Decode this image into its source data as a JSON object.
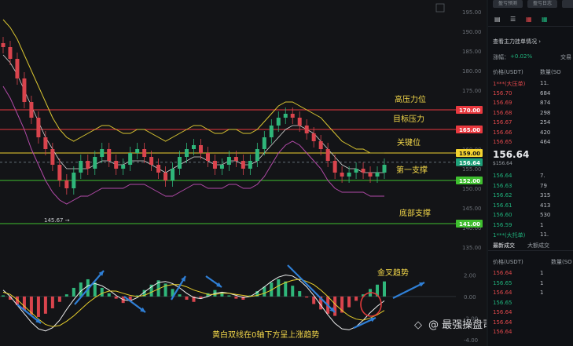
{
  "chart_data": {
    "type": "line",
    "price_axis": {
      "ticks": [
        "195.00",
        "190.00",
        "185.00",
        "180.00",
        "175.00",
        "170.00",
        "165.00",
        "160.00",
        "155.00",
        "150.00",
        "145.00",
        "140.00",
        "135.00"
      ],
      "tick_values": [
        195,
        190,
        185,
        180,
        175,
        170,
        165,
        160,
        155,
        150,
        145,
        140,
        135
      ],
      "range": [
        132,
        196
      ]
    },
    "indicator_axis": {
      "ticks": [
        "2.00",
        "0.00",
        "-2.00",
        "-4.00"
      ],
      "tick_values": [
        2,
        0,
        -2,
        -4
      ],
      "range": [
        -4.6,
        3.2
      ]
    },
    "levels": [
      {
        "label": "高压力位",
        "tag": "170.00",
        "value": 170.0,
        "color": "#e8393f"
      },
      {
        "label": "目标压力",
        "tag": "165.00",
        "value": 165.0,
        "color": "#e8393f"
      },
      {
        "label": "关键位",
        "tag": "159.00",
        "value": 159.0,
        "color": "#f2d230"
      },
      {
        "label": "第一支撑",
        "tag": "152.00",
        "value": 152.0,
        "color": "#3fbf2f"
      },
      {
        "label": "底部支撑",
        "tag": "141.00",
        "value": 141.0,
        "color": "#3fbf2f"
      }
    ],
    "current_price_tag": "156.64",
    "current_price": 156.64,
    "low_marker": "145.67",
    "close_series": [
      186,
      183,
      178,
      172,
      168,
      163,
      160,
      156,
      152,
      150,
      154,
      157,
      155,
      158,
      160,
      157,
      155,
      156,
      159,
      160,
      158,
      156,
      154,
      152,
      155,
      158,
      160,
      161,
      159,
      157,
      155,
      156,
      158,
      157,
      155,
      157,
      160,
      163,
      166,
      168,
      169,
      168,
      166,
      164,
      162,
      160,
      157,
      154,
      153,
      154,
      155,
      154,
      153,
      154,
      156
    ],
    "upper_band": [
      193,
      191,
      188,
      184,
      180,
      176,
      172,
      168,
      165,
      163,
      162,
      163,
      164,
      165,
      166,
      166,
      165,
      164,
      164,
      165,
      165,
      164,
      163,
      162,
      163,
      164,
      165,
      166,
      166,
      165,
      164,
      164,
      165,
      165,
      164,
      164,
      165,
      167,
      169,
      171,
      172,
      172,
      171,
      170,
      169,
      168,
      166,
      164,
      162,
      161,
      160,
      160,
      159,
      159,
      159
    ],
    "lower_band": [
      176,
      173,
      169,
      165,
      160,
      156,
      152,
      149,
      147,
      146,
      147,
      148,
      148,
      149,
      150,
      150,
      150,
      150,
      151,
      151,
      151,
      150,
      149,
      148,
      148,
      149,
      150,
      151,
      151,
      150,
      150,
      150,
      151,
      151,
      150,
      150,
      151,
      153,
      156,
      159,
      161,
      162,
      161,
      159,
      157,
      155,
      152,
      150,
      149,
      149,
      149,
      149,
      148,
      148,
      148
    ],
    "ma_series": [
      184,
      182,
      179,
      175,
      171,
      167,
      163,
      160,
      157,
      155,
      155,
      155,
      155,
      156,
      157,
      157,
      156,
      156,
      157,
      157,
      157,
      156,
      155,
      154,
      155,
      156,
      157,
      158,
      158,
      157,
      156,
      156,
      157,
      157,
      156,
      156,
      157,
      159,
      161,
      163,
      165,
      166,
      166,
      165,
      164,
      162,
      160,
      158,
      156,
      155,
      155,
      154,
      154,
      154,
      154
    ],
    "macd_histogram": [
      0.1,
      -0.3,
      -0.8,
      -1.3,
      -1.7,
      -1.9,
      -1.6,
      -1.1,
      -0.5,
      0.2,
      0.8,
      1.3,
      1.6,
      1.3,
      0.8,
      0.3,
      -0.2,
      -0.6,
      -0.4,
      0.1,
      0.6,
      1.1,
      1.5,
      1.2,
      0.7,
      0.2,
      -0.3,
      -0.5,
      -0.2,
      0.3,
      0.6,
      0.4,
      0.1,
      -0.2,
      -0.3,
      0.1,
      0.5,
      0.9,
      1.3,
      1.6,
      1.4,
      1.0,
      0.5,
      -0.1,
      -0.7,
      -1.2,
      -1.6,
      -1.8,
      -1.5,
      -1.0,
      -0.4,
      0.2,
      0.7,
      1.1,
      1.4
    ],
    "dif_line": [
      0.6,
      0.0,
      -0.8,
      -1.6,
      -2.4,
      -3.0,
      -3.2,
      -2.9,
      -2.2,
      -1.2,
      -0.3,
      0.5,
      1.0,
      1.2,
      1.0,
      0.6,
      0.1,
      -0.3,
      -0.4,
      -0.1,
      0.4,
      0.9,
      1.3,
      1.4,
      1.2,
      0.8,
      0.3,
      -0.1,
      -0.2,
      0.0,
      0.3,
      0.4,
      0.3,
      0.1,
      -0.1,
      0.0,
      0.4,
      0.9,
      1.4,
      1.8,
      2.0,
      1.9,
      1.5,
      0.9,
      0.1,
      -0.8,
      -1.7,
      -2.5,
      -3.0,
      -3.1,
      -2.8,
      -2.2,
      -1.5,
      -0.9,
      -0.4
    ],
    "dea_line": [
      0.4,
      0.2,
      -0.3,
      -0.9,
      -1.5,
      -2.1,
      -2.6,
      -2.8,
      -2.7,
      -2.3,
      -1.8,
      -1.2,
      -0.6,
      -0.1,
      0.3,
      0.5,
      0.5,
      0.3,
      0.1,
      0.0,
      0.1,
      0.4,
      0.7,
      1.0,
      1.1,
      1.1,
      0.9,
      0.6,
      0.4,
      0.2,
      0.2,
      0.3,
      0.3,
      0.2,
      0.1,
      0.0,
      0.1,
      0.3,
      0.6,
      1.0,
      1.3,
      1.5,
      1.6,
      1.4,
      1.1,
      0.6,
      0.0,
      -0.7,
      -1.3,
      -1.8,
      -2.1,
      -2.2,
      -2.0,
      -1.7,
      -1.3
    ],
    "annotations": [
      "金叉趋势",
      "黄白双线在0轴下方呈上涨趋势"
    ],
    "grid": false
  },
  "watermark": "最强操盘司令",
  "side_panel": {
    "top_buttons": [
      "盈亏预测",
      "盈亏日志",
      ""
    ],
    "section_link": "查看主力挂单情况",
    "change_label": "涨幅：",
    "change_value": "+0.02%",
    "change_right": "交易",
    "col_price": "价格(USDT)",
    "col_qty": "数量(SO",
    "ask_rows": [
      {
        "price": "1***(大压单)",
        "qty": "11."
      },
      {
        "price": "156.70",
        "qty": "684"
      },
      {
        "price": "156.69",
        "qty": "874"
      },
      {
        "price": "156.68",
        "qty": "298"
      },
      {
        "price": "156.67",
        "qty": "254"
      },
      {
        "price": "156.66",
        "qty": "420"
      },
      {
        "price": "156.65",
        "qty": "464"
      }
    ],
    "last_price": "156.64",
    "last_price_sub": "$156.64",
    "bid_rows": [
      {
        "price": "156.64",
        "qty": "7."
      },
      {
        "price": "156.63",
        "qty": "79"
      },
      {
        "price": "156.62",
        "qty": "315"
      },
      {
        "price": "156.61",
        "qty": "413"
      },
      {
        "price": "156.60",
        "qty": "530"
      },
      {
        "price": "156.59",
        "qty": "1"
      },
      {
        "price": "1***(大托单)",
        "qty": "11."
      }
    ],
    "trades_tab_1": "最新成交",
    "trades_tab_2": "大额成交",
    "trade_col_price": "价格(USDT)",
    "trade_col_qty": "数量(SO",
    "trade_rows": [
      {
        "price": "156.64",
        "qty": "1",
        "side": "red"
      },
      {
        "price": "156.65",
        "qty": "1",
        "side": "green"
      },
      {
        "price": "156.64",
        "qty": "1",
        "side": "red"
      },
      {
        "price": "156.65",
        "qty": "",
        "side": "green"
      },
      {
        "price": "156.64",
        "qty": "",
        "side": "red"
      },
      {
        "price": "156.64",
        "qty": "",
        "side": "red"
      },
      {
        "price": "156.64",
        "qty": "",
        "side": "red"
      }
    ]
  }
}
